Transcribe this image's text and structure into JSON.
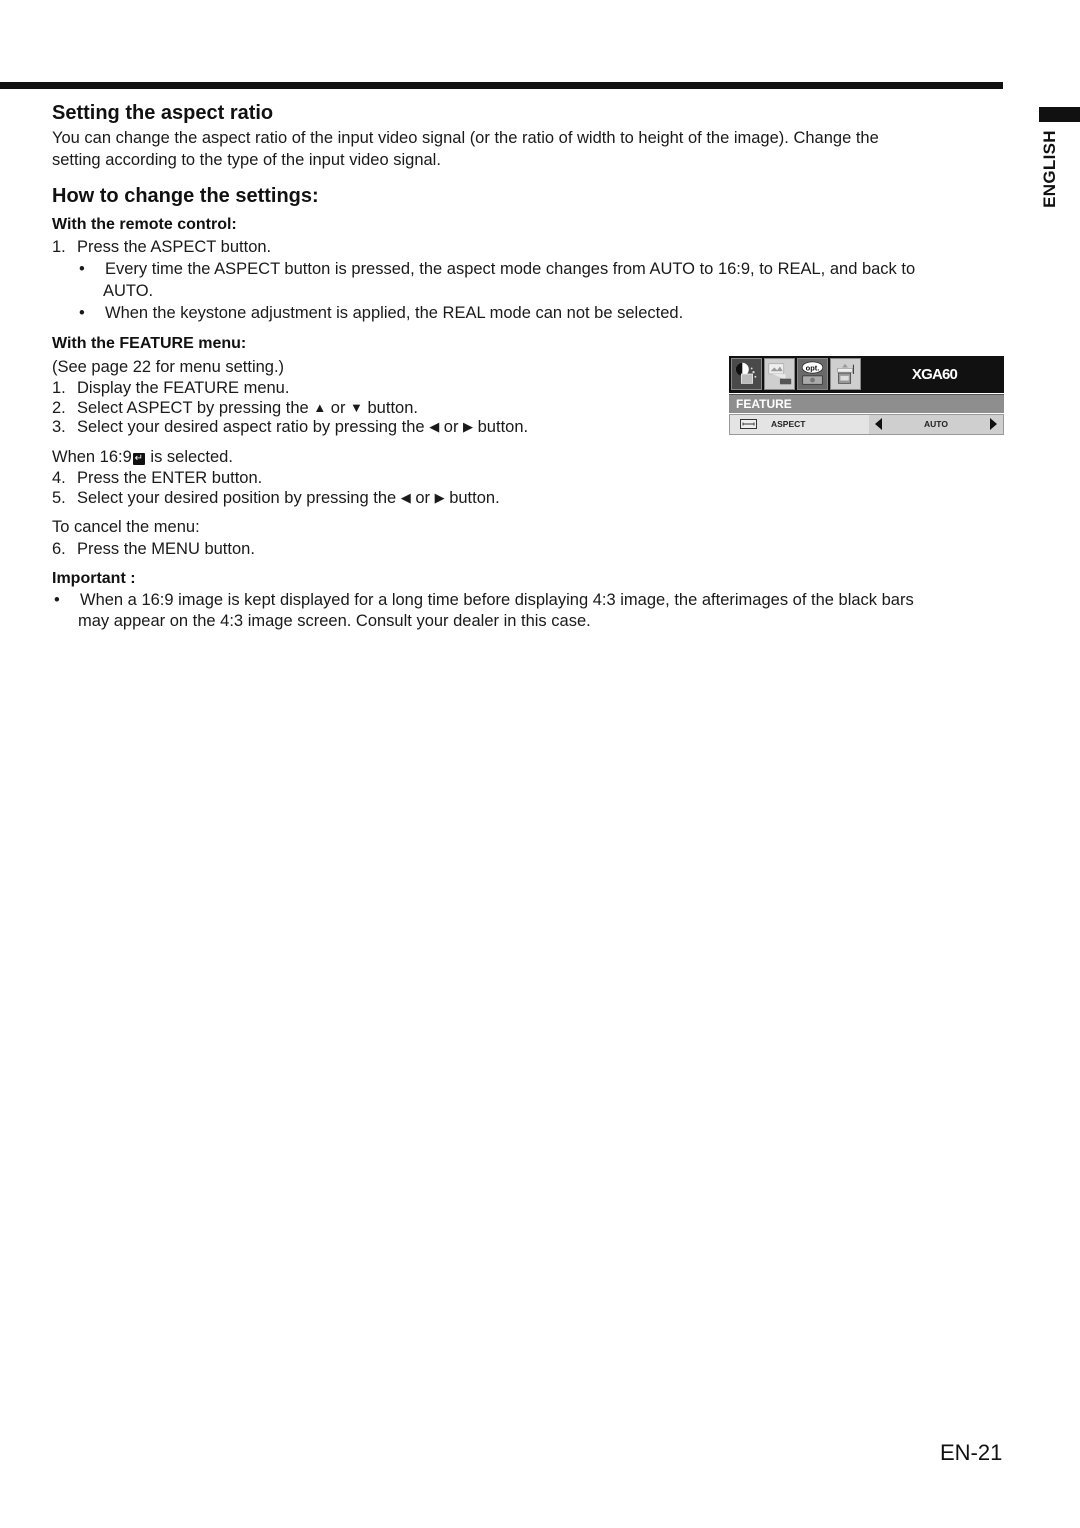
{
  "side_tab": {
    "label": "ENGLISH"
  },
  "section": {
    "title": "Setting the aspect ratio",
    "intro_lines": [
      "You can change the aspect ratio of the input video signal (or the ratio of width to height of the image). Change the",
      "setting according to the type of the input video signal."
    ]
  },
  "how_to": {
    "title": "How to change the settings:",
    "remote": {
      "heading": "With the remote control:",
      "step1_num": "1.",
      "step1": "Press the ASPECT button.",
      "bullet": "•",
      "bullet1_line1": "Every time the ASPECT button is pressed, the aspect mode changes from AUTO to 16:9, to REAL, and back to",
      "bullet1_line2": "AUTO.",
      "bullet2": "When the keystone adjustment is applied, the REAL mode can not be selected."
    },
    "feature_menu": {
      "heading": "With the FEATURE menu:",
      "see_page": "(See page 22 for menu setting.)",
      "steps": [
        {
          "num": "1.",
          "text": "Display the FEATURE menu."
        },
        {
          "num": "2.",
          "pre": "Select ASPECT by pressing the ",
          "up_icon": "▲",
          "mid": " or ",
          "down_icon": "▼",
          "post": " button."
        },
        {
          "num": "3.",
          "pre": "Select your desired aspect ratio by pressing the ",
          "left_icon": "◀",
          "mid": " or ",
          "right_icon": "▶",
          "post": " button."
        }
      ],
      "when_pre": "When 16:9",
      "when_icon": "↵",
      "when_post": " is selected.",
      "steps_after": [
        {
          "num": "4.",
          "text": "Press the ENTER button."
        },
        {
          "num": "5.",
          "pre": "Select your desired position  by pressing the ",
          "left_icon": "◀",
          "mid": " or ",
          "right_icon": "▶",
          "post": " button."
        }
      ],
      "cancel_heading": "To cancel the menu:",
      "step6": {
        "num": "6.",
        "text": "Press the MENU button."
      }
    },
    "important": {
      "heading": "Important :",
      "bullet": "•",
      "line1": "When a 16:9 image is kept displayed for a long time before displaying 4:3 image, the afterimages of the black bars",
      "line2": "may appear on the 4:3 image screen. Consult your dealer in this case."
    }
  },
  "osd_menu": {
    "tabs": [
      {
        "name": "picture-icon",
        "selected": true
      },
      {
        "name": "image-icon",
        "selected": false
      },
      {
        "name": "option-icon",
        "label": "opt.",
        "selected": false
      },
      {
        "name": "installation-icon",
        "selected": false
      }
    ],
    "model": "XGA60",
    "menu_title": "FEATURE",
    "row": {
      "label": "ASPECT",
      "value": "AUTO"
    },
    "colors": {
      "header_bg": "#111111",
      "title_bar": "#8e8e8e",
      "row_bg": "#d9d9d9"
    }
  },
  "page_number": "EN-21"
}
